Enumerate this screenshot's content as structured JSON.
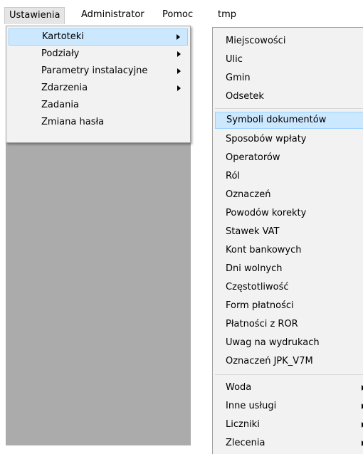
{
  "menubar": {
    "items": [
      "Ustawienia",
      "Administrator",
      "Pomoc",
      "tmp"
    ]
  },
  "menu1": {
    "items": [
      {
        "label": "Kartoteki",
        "submenu": true
      },
      {
        "label": "Podziały",
        "submenu": true
      },
      {
        "label": "Parametry instalacyjne",
        "submenu": true
      },
      {
        "label": "Zdarzenia",
        "submenu": true
      },
      {
        "label": "Zadania",
        "submenu": false
      },
      {
        "label": "Zmiana hasła",
        "submenu": false
      }
    ]
  },
  "menu2": {
    "items": [
      {
        "label": "Miejscowości"
      },
      {
        "label": "Ulic"
      },
      {
        "label": "Gmin"
      },
      {
        "label": "Odsetek"
      },
      {
        "label": "Symboli dokumentów"
      },
      {
        "label": "Sposobów wpłaty"
      },
      {
        "label": "Operatorów"
      },
      {
        "label": "Ról"
      },
      {
        "label": "Oznaczeń"
      },
      {
        "label": "Powodów korekty"
      },
      {
        "label": "Stawek VAT"
      },
      {
        "label": "Kont bankowych"
      },
      {
        "label": "Dni wolnych"
      },
      {
        "label": "Częstotliwość"
      },
      {
        "label": "Form płatności"
      },
      {
        "label": "Płatności z ROR"
      },
      {
        "label": "Uwag na wydrukach"
      },
      {
        "label": "Oznaczeń JPK_V7M"
      },
      {
        "label": "Woda",
        "submenu": true
      },
      {
        "label": "Inne usługi",
        "submenu": true
      },
      {
        "label": "Liczniki",
        "submenu": true
      },
      {
        "label": "Zlecenia",
        "submenu": true
      }
    ]
  }
}
